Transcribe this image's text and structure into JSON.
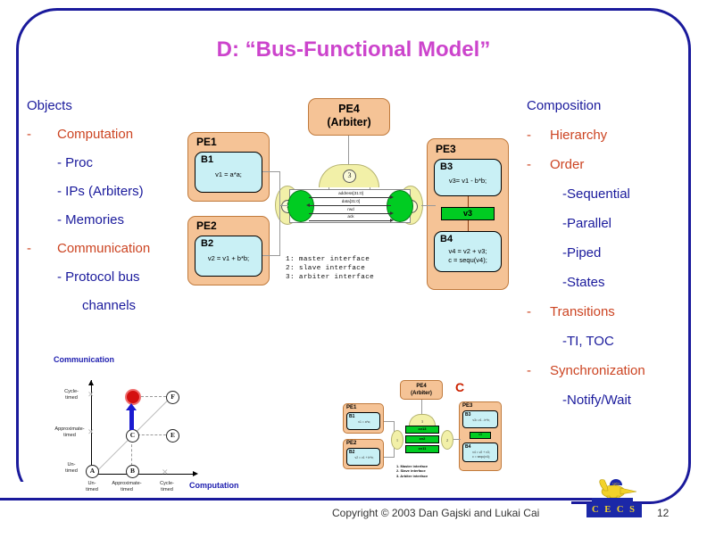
{
  "slide": {
    "title": "D: “Bus-Functional Model”",
    "page_number": "12",
    "copyright": "Copyright © 2003 Dan Gajski and Lukai Cai",
    "logo_text": "C E C S"
  },
  "colors": {
    "title": "#cc44cc",
    "heading": "#1a1a9c",
    "bullet": "#cc4422",
    "frame": "#1a1a9c",
    "pe_fill": "#f5c396",
    "behavior_fill": "#c9f0f5",
    "channel_green": "#00cc22",
    "interface_yellow": "#f2f0a8"
  },
  "left_column": {
    "heading": "Objects",
    "items": [
      {
        "dash": "-",
        "label": "Computation",
        "level": 1
      },
      {
        "dash": "",
        "label": "- Proc",
        "level": 2
      },
      {
        "dash": "",
        "label": "- IPs (Arbiters)",
        "level": 2
      },
      {
        "dash": "",
        "label": "- Memories",
        "level": 2
      },
      {
        "dash": "-",
        "label": "Communication",
        "level": 1
      },
      {
        "dash": "",
        "label": "- Protocol bus",
        "level": 2
      },
      {
        "dash": "",
        "label": "channels",
        "level": 3
      }
    ]
  },
  "right_column": {
    "heading": "Composition",
    "items": [
      {
        "dash": "-",
        "label": "Hierarchy",
        "level": 1
      },
      {
        "dash": "-",
        "label": "Order",
        "level": 1
      },
      {
        "dash": "",
        "label": "-Sequential",
        "level": 2
      },
      {
        "dash": "",
        "label": "-Parallel",
        "level": 2
      },
      {
        "dash": "",
        "label": "-Piped",
        "level": 2
      },
      {
        "dash": "",
        "label": "-States",
        "level": 2
      },
      {
        "dash": "-",
        "label": "Transitions",
        "level": 1
      },
      {
        "dash": "",
        "label": "-TI, TOC",
        "level": 2
      },
      {
        "dash": "-",
        "label": "Synchronization",
        "level": 1
      },
      {
        "dash": "",
        "label": "-Notify/Wait",
        "level": 2
      }
    ]
  },
  "diagram": {
    "pe1": {
      "title": "PE1",
      "behavior": "B1",
      "code": "v1 = a*a;"
    },
    "pe2": {
      "title": "PE2",
      "behavior": "B2",
      "code": "v2 = v1 + b*b;"
    },
    "pe3": {
      "title": "PE3",
      "behavior1": "B3",
      "code1": "v3= v1 - b*b;",
      "channel": "v3",
      "behavior2": "B4",
      "code2a": "v4 = v2 + v3;",
      "code2b": "c = sequ(v4);"
    },
    "pe4": {
      "line1": "PE4",
      "line2": "(Arbiter)"
    },
    "bus_signals": [
      "address[31:0]",
      "data[31:0]",
      "rwd",
      "ack"
    ],
    "interface_numbers": {
      "master": "1",
      "slave": "2",
      "arbiter": "3"
    },
    "legend": [
      "1: master interface",
      "2: slave interface",
      "3: arbiter interface"
    ]
  },
  "ychart": {
    "y_axis_label": "Communication",
    "x_axis_label": "Computation",
    "y_ticks": [
      "Cycle-\ntimed",
      "Approximate-\ntimed",
      "Un-\ntimed"
    ],
    "y_tick_lines": [
      {
        "l1": "Cycle-",
        "l2": "timed"
      },
      {
        "l1": "Approximate-",
        "l2": "timed"
      },
      {
        "l1": "Un-",
        "l2": "timed"
      }
    ],
    "x_tick_lines": [
      {
        "l1": "Un-",
        "l2": "timed"
      },
      {
        "l1": "Approximate-",
        "l2": "timed"
      },
      {
        "l1": "Cycle-",
        "l2": "timed"
      }
    ],
    "nodes": [
      {
        "id": "A",
        "highlight": false
      },
      {
        "id": "B",
        "highlight": false
      },
      {
        "id": "C",
        "highlight": false
      },
      {
        "id": "D",
        "highlight": true
      },
      {
        "id": "E",
        "highlight": false
      },
      {
        "id": "F",
        "highlight": false
      }
    ]
  },
  "mini_diagram": {
    "marker": "C",
    "pe1": {
      "title": "PE1",
      "behavior": "B1",
      "code": "v1 = a*a;"
    },
    "pe2": {
      "title": "PE2",
      "behavior": "B2",
      "code": "v2 = v1 + b*b;"
    },
    "pe3": {
      "title": "PE3",
      "behavior1": "B3",
      "code1": "v3= v1 - b*b;",
      "channel": "v3",
      "behavior2": "B4",
      "code2a": "v4 = v2 + v3;",
      "code2b": "c = sequ(v4);"
    },
    "pe4": {
      "line1": "PE4",
      "line2": "(Arbiter)"
    },
    "channels": [
      "cv13",
      "cv2",
      "cv11"
    ],
    "interface_numbers": {
      "master": "1",
      "slave": "2",
      "arbiter": "3"
    },
    "legend": [
      "1. Master interface",
      "2. Slave interface",
      "3. Arbiter interface"
    ]
  }
}
